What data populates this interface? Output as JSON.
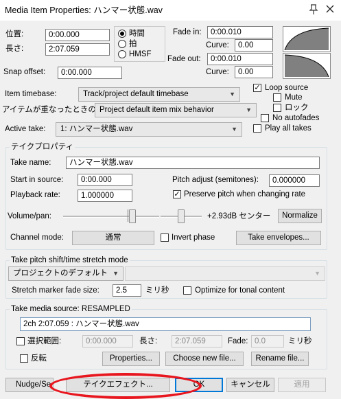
{
  "window": {
    "title": "Media Item Properties: ハンマー状態.wav"
  },
  "position": {
    "position_label": "位置:",
    "position_value": "0:00.000",
    "length_label": "長さ:",
    "length_value": "2:07.059",
    "snap_label": "Snap offset:",
    "snap_value": "0:00.000",
    "time_modes": [
      "時間",
      "拍",
      "HMSF"
    ],
    "selected_mode": "時間"
  },
  "fades": {
    "fade_in_label": "Fade in:",
    "fade_in_value": "0:00.010",
    "curve_label": "Curve:",
    "fade_in_curve": "0.00",
    "fade_out_label": "Fade out:",
    "fade_out_value": "0:00.010",
    "fade_out_curve": "0.00"
  },
  "item": {
    "timebase_label": "Item timebase:",
    "timebase_value": "Track/project default timebase",
    "overlap_label": "アイテムが重なったときの動",
    "overlap_value": "Project default item mix behavior",
    "active_take_label": "Active take:",
    "active_take_value": "1: ハンマー状態.wav",
    "loop_source": "Loop source",
    "mute": "Mute",
    "lock": "ロック",
    "no_autofades": "No autofades",
    "play_all_takes": "Play all takes"
  },
  "take": {
    "group_title": "テイクプロパティ",
    "name_label": "Take name:",
    "name_value": "ハンマー状態.wav",
    "start_label": "Start in source:",
    "start_value": "0:00.000",
    "rate_label": "Playback rate:",
    "rate_value": "1.000000",
    "pitch_label": "Pitch adjust (semitones):",
    "pitch_value": "0.000000",
    "preserve_pitch": "Preserve pitch when changing rate",
    "volpan_label": "Volume/pan:",
    "volpan_readout": "+2.93dB センター",
    "volume_level": 0.73,
    "pan_level": 0.5,
    "normalize": "Normalize",
    "channel_label": "Channel mode:",
    "channel_value": "通常",
    "invert_phase": "Invert phase",
    "take_envelopes": "Take envelopes..."
  },
  "pitch_shift": {
    "group_title": "Take pitch shift/time stretch mode",
    "mode_value": "プロジェクトのデフォルト",
    "stretch_label": "Stretch marker fade size:",
    "stretch_value": "2.5",
    "stretch_unit": "ミリ秒",
    "optimize_tonal": "Optimize for tonal content"
  },
  "media_source": {
    "group_title": "Take media source:  RESAMPLED",
    "source_value": "2ch 2:07.059 : ハンマー状態.wav",
    "section_label": "選択範囲:",
    "section_start": "0:00.000",
    "section_len_label": "長さ:",
    "section_len": "2:07.059",
    "section_fade_label": "Fade:",
    "section_fade": "0.0",
    "section_fade_unit": "ミリ秒",
    "reverse": "反転",
    "properties": "Properties...",
    "choose_new_file": "Choose new file...",
    "rename_file": "Rename file..."
  },
  "footer": {
    "nudge": "Nudge/Se",
    "take_fx": "テイクエフェクト...",
    "ok": "OK",
    "cancel": "キャンセル",
    "apply": "適用"
  },
  "colors": {
    "annotation": "#e8161e",
    "focus": "#0078d7"
  }
}
